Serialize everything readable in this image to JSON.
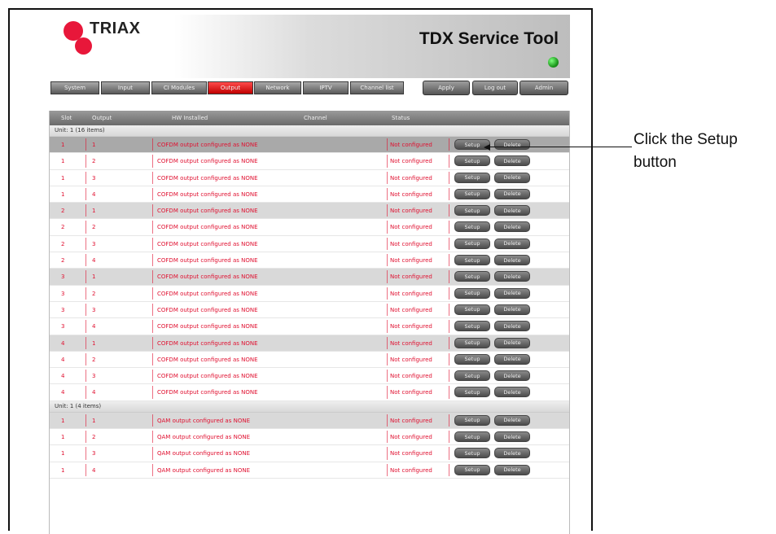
{
  "header": {
    "logo_text": "TRIAX",
    "title": "TDX Service Tool"
  },
  "nav": {
    "tabs": [
      "System",
      "Input",
      "CI Modules",
      "Output",
      "Network",
      "IPTV",
      "Channel list"
    ],
    "active": "Output",
    "right_buttons": [
      "Apply",
      "Log out",
      "Admin"
    ]
  },
  "table": {
    "columns": [
      "Slot",
      "Output",
      "HW Installed",
      "Channel",
      "Status"
    ],
    "groups": [
      {
        "label": "Unit: 1 (16 items)",
        "rows": [
          [
            "1",
            "1",
            "COFDM output configured as NONE",
            "",
            "Not configured"
          ],
          [
            "1",
            "2",
            "COFDM output configured as NONE",
            "",
            "Not configured"
          ],
          [
            "1",
            "3",
            "COFDM output configured as NONE",
            "",
            "Not configured"
          ],
          [
            "1",
            "4",
            "COFDM output configured as NONE",
            "",
            "Not configured"
          ],
          [
            "2",
            "1",
            "COFDM output configured as NONE",
            "",
            "Not configured"
          ],
          [
            "2",
            "2",
            "COFDM output configured as NONE",
            "",
            "Not configured"
          ],
          [
            "2",
            "3",
            "COFDM output configured as NONE",
            "",
            "Not configured"
          ],
          [
            "2",
            "4",
            "COFDM output configured as NONE",
            "",
            "Not configured"
          ],
          [
            "3",
            "1",
            "COFDM output configured as NONE",
            "",
            "Not configured"
          ],
          [
            "3",
            "2",
            "COFDM output configured as NONE",
            "",
            "Not configured"
          ],
          [
            "3",
            "3",
            "COFDM output configured as NONE",
            "",
            "Not configured"
          ],
          [
            "3",
            "4",
            "COFDM output configured as NONE",
            "",
            "Not configured"
          ],
          [
            "4",
            "1",
            "COFDM output configured as NONE",
            "",
            "Not configured"
          ],
          [
            "4",
            "2",
            "COFDM output configured as NONE",
            "",
            "Not configured"
          ],
          [
            "4",
            "3",
            "COFDM output configured as NONE",
            "",
            "Not configured"
          ],
          [
            "4",
            "4",
            "COFDM output configured as NONE",
            "",
            "Not configured"
          ]
        ]
      },
      {
        "label": "Unit: 1 (4 items)",
        "rows": [
          [
            "1",
            "1",
            "QAM output configured as NONE",
            "",
            "Not configured"
          ],
          [
            "1",
            "2",
            "QAM output configured as NONE",
            "",
            "Not configured"
          ],
          [
            "1",
            "3",
            "QAM output configured as NONE",
            "",
            "Not configured"
          ],
          [
            "1",
            "4",
            "QAM output configured as NONE",
            "",
            "Not configured"
          ]
        ]
      }
    ],
    "setup_label": "Setup",
    "delete_label": "Delete"
  },
  "callout": {
    "line1": "Click the Setup",
    "line2": "button"
  },
  "colors": {
    "accent": "#e01030",
    "active_tab": "#d40000",
    "status_led": "#1e9a1e"
  }
}
